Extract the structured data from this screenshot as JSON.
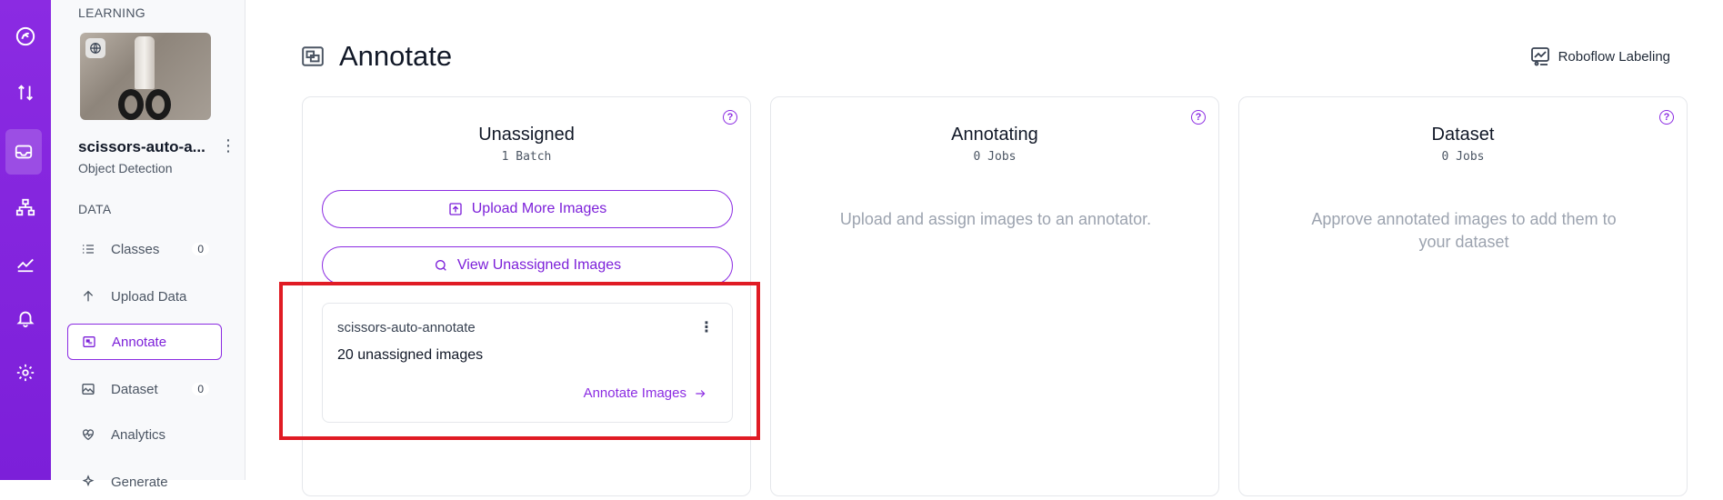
{
  "rail": {
    "icons": [
      "roboflow-logo-icon",
      "transfer-icon",
      "inbox-icon",
      "workflow-icon",
      "chart-icon",
      "bell-icon",
      "gear-icon"
    ]
  },
  "sidebar": {
    "section_learning": "LEARNING",
    "project_name": "scissors-auto-a...",
    "project_type": "Object Detection",
    "section_data": "DATA",
    "items": [
      {
        "label": "Classes",
        "count": "0",
        "icon": "list-icon"
      },
      {
        "label": "Upload Data",
        "icon": "arrow-up-icon"
      },
      {
        "label": "Annotate",
        "icon": "annotate-icon"
      },
      {
        "label": "Dataset",
        "count": "0",
        "icon": "image-icon"
      },
      {
        "label": "Analytics",
        "icon": "heart-pulse-icon"
      },
      {
        "label": "Generate",
        "icon": "sparkle-icon"
      }
    ]
  },
  "header": {
    "title": "Annotate",
    "labeling_button": "Roboflow Labeling"
  },
  "columns": [
    {
      "title": "Unassigned",
      "subtitle": "1 Batch",
      "upload_button": "Upload More Images",
      "view_button": "View Unassigned Images",
      "batch": {
        "name": "scissors-auto-annotate",
        "count_text": "20 unassigned images",
        "link": "Annotate Images"
      }
    },
    {
      "title": "Annotating",
      "subtitle": "0 Jobs",
      "empty_text": "Upload and assign images to an annotator."
    },
    {
      "title": "Dataset",
      "subtitle": "0 Jobs",
      "empty_text": "Approve annotated images to add them to your dataset"
    }
  ],
  "colors": {
    "accent": "#8b2be2",
    "highlight": "#e01b24"
  }
}
